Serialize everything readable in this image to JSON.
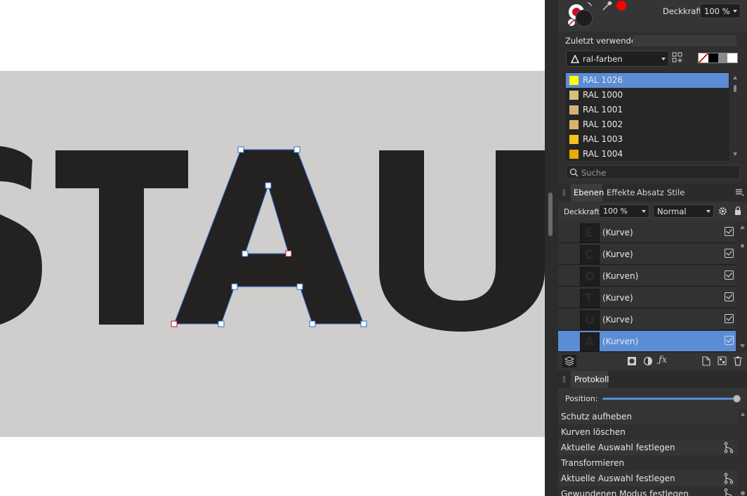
{
  "canvas": {
    "text": "STAU",
    "colors": {
      "background": "#ffffff",
      "artboard": "#cfcecd",
      "letters": "#232221",
      "selection": "#2f6fd0",
      "node": "#ffffff",
      "node_selected": "#c8102e"
    }
  },
  "color_panel": {
    "deckkraft_label": "Deckkraft:",
    "deckkraft_value": "100 %",
    "recent_label": "Zuletzt verwendet:",
    "palette_name": "ral-farben",
    "swatch_strip": [
      "#ffffff",
      "#000000",
      "#8a8a8a",
      "#ffffff"
    ],
    "swatches": [
      {
        "name": "RAL 1026",
        "color": "#ffff00",
        "selected": true
      },
      {
        "name": "RAL 1000",
        "color": "#d4c27d",
        "selected": false
      },
      {
        "name": "RAL 1001",
        "color": "#d6b27a",
        "selected": false
      },
      {
        "name": "RAL 1002",
        "color": "#dcb36a",
        "selected": false
      },
      {
        "name": "RAL 1003",
        "color": "#f6c21c",
        "selected": false
      },
      {
        "name": "RAL 1004",
        "color": "#e8a900",
        "selected": false
      }
    ],
    "search_placeholder": "Suche",
    "icons": {
      "fill": "fill-stroke-icon",
      "picker": "eyedropper-icon",
      "palette": "palette-triangle-icon",
      "add": "add-grid-icon",
      "search": "search-icon"
    },
    "accent": "#ff0000"
  },
  "layers_panel": {
    "tabs": [
      {
        "label": "Ebenen",
        "active": true
      },
      {
        "label": "Effekte",
        "active": false
      },
      {
        "label": "Absatz",
        "active": false
      },
      {
        "label": "Stile",
        "active": false
      }
    ],
    "deckkraft_label": "Deckkraft:",
    "deckkraft_value": "100 %",
    "blend_mode": "Normal",
    "layers": [
      {
        "name": "(Kurve)",
        "glyph": "E",
        "selected": false,
        "visible": true
      },
      {
        "name": "(Kurve)",
        "glyph": "C",
        "selected": false,
        "visible": true
      },
      {
        "name": "(Kurven)",
        "glyph": "O",
        "selected": false,
        "visible": true
      },
      {
        "name": "(Kurve)",
        "glyph": "T",
        "selected": false,
        "visible": true
      },
      {
        "name": "(Kurve)",
        "glyph": "U",
        "selected": false,
        "visible": true
      },
      {
        "name": "(Kurven)",
        "glyph": "A",
        "selected": true,
        "visible": true
      }
    ],
    "accent": "#5b8dd6"
  },
  "history_panel": {
    "tab_label": "Protokoll",
    "position_label": "Position:",
    "position_value": 1.0,
    "entries": [
      {
        "label": "Schutz aufheben",
        "branch": false
      },
      {
        "label": "Kurven löschen",
        "branch": false
      },
      {
        "label": "Aktuelle Auswahl festlegen",
        "branch": true
      },
      {
        "label": "Transformieren",
        "branch": false
      },
      {
        "label": "Aktuelle Auswahl festlegen",
        "branch": true
      },
      {
        "label": "Gewundenen Modus festlegen",
        "branch": true
      }
    ]
  }
}
